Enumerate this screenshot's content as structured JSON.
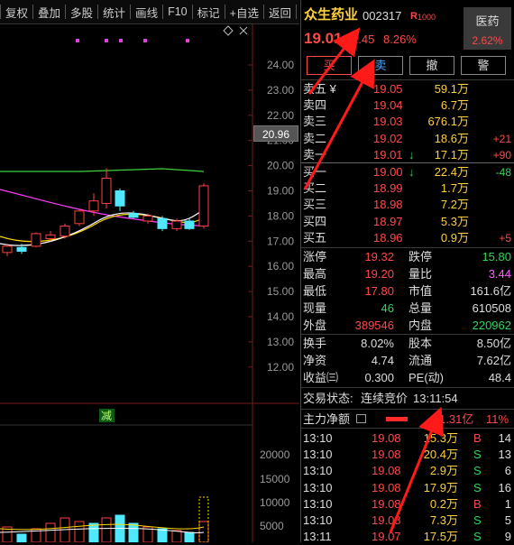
{
  "toolbar": {
    "items": [
      "复权",
      "叠加",
      "多股",
      "统计",
      "画线",
      "F10",
      "标记",
      "+自选",
      "返回"
    ]
  },
  "chart": {
    "price_axis": [
      "24.00",
      "23.00",
      "22.00",
      "21.00",
      "20.00",
      "19.00",
      "18.00",
      "17.00",
      "16.00",
      "15.00",
      "14.00",
      "13.00",
      "12.00"
    ],
    "current_price_box": "20.96",
    "volume_axis": [
      "20000",
      "15000",
      "10000",
      "5000"
    ],
    "marker_text": "减",
    "diamond_icon": "diamond-icon",
    "close_icon": "close-icon",
    "candle_up_color": "#ff4040",
    "candle_down_color": "#4fe8ff",
    "ma_colors": [
      "#ffffff",
      "#ffd800",
      "#ff3cff",
      "#3cd23c"
    ]
  },
  "quote": {
    "name": "众生药业",
    "code": "002317",
    "badge": "R",
    "badge_sub": "1000",
    "sector": "医药",
    "sector_change": "2.62%",
    "price": "19.01",
    "change": "1.45",
    "change_pct": "8.26%"
  },
  "actions": [
    "买",
    "卖",
    "撤",
    "警"
  ],
  "sell": [
    {
      "label": "卖五 ¥",
      "price": "19.05",
      "vol": "59.1万",
      "delta": ""
    },
    {
      "label": "卖四",
      "price": "19.04",
      "vol": "6.7万",
      "delta": ""
    },
    {
      "label": "卖三",
      "price": "19.03",
      "vol": "676.1万",
      "delta": ""
    },
    {
      "label": "卖二",
      "price": "19.02",
      "vol": "18.6万",
      "delta": "+21"
    },
    {
      "label": "卖一",
      "price": "19.01",
      "arrow": "↓",
      "vol": "17.1万",
      "delta": "+90"
    }
  ],
  "buy": [
    {
      "label": "买一",
      "price": "19.00",
      "arrow": "↓",
      "vol": "22.4万",
      "delta": "-48"
    },
    {
      "label": "买二",
      "price": "18.99",
      "vol": "1.7万",
      "delta": ""
    },
    {
      "label": "买三",
      "price": "18.98",
      "vol": "7.2万",
      "delta": ""
    },
    {
      "label": "买四",
      "price": "18.97",
      "vol": "5.3万",
      "delta": ""
    },
    {
      "label": "买五",
      "price": "18.96",
      "vol": "0.9万",
      "delta": "+5"
    }
  ],
  "stats1": [
    {
      "l1": "涨停",
      "v1": "19.32",
      "l2": "跌停",
      "v2": "15.80"
    },
    {
      "l1": "最高",
      "v1": "19.20",
      "l2": "量比",
      "v2": "3.44"
    },
    {
      "l1": "最低",
      "v1": "17.80",
      "l2": "市值",
      "v2": "161.6亿"
    },
    {
      "l1": "现量",
      "v1": "46",
      "l2": "总量",
      "v2": "610508"
    },
    {
      "l1": "外盘",
      "v1": "389546",
      "l2": "内盘",
      "v2": "220962"
    }
  ],
  "stats2": [
    {
      "l1": "换手",
      "v1": "8.02%",
      "l2": "股本",
      "v2": "8.50亿"
    },
    {
      "l1": "净资",
      "v1": "4.74",
      "l2": "流通",
      "v2": "7.62亿"
    },
    {
      "l1": "收益(",
      "v1": "0.300",
      "l2": "PE(动)",
      "v2": "48.4"
    }
  ],
  "stats2_labels_fix": {
    "eps": "收益㈢"
  },
  "trade_status": {
    "label": "交易状态:",
    "value": "连续竞价",
    "time": "13:11:54"
  },
  "main_flow": {
    "label": "主力净额",
    "value": "1.31亿",
    "pct": "11%"
  },
  "ticks": [
    {
      "time": "13:10",
      "price": "19.08",
      "vol": "15.3万",
      "side": "B",
      "n": "14"
    },
    {
      "time": "13:10",
      "price": "19.08",
      "vol": "20.4万",
      "side": "S",
      "n": "13"
    },
    {
      "time": "13:10",
      "price": "19.08",
      "vol": "2.9万",
      "side": "S",
      "n": "6"
    },
    {
      "time": "13:10",
      "price": "19.08",
      "vol": "17.9万",
      "side": "S",
      "n": "16"
    },
    {
      "time": "13:10",
      "price": "19.08",
      "vol": "0.2万",
      "side": "B",
      "n": "1"
    },
    {
      "time": "13:10",
      "price": "19.08",
      "vol": "7.3万",
      "side": "S",
      "n": "5"
    },
    {
      "time": "13:11",
      "price": "19.07",
      "vol": "17.5万",
      "side": "S",
      "n": "9"
    }
  ]
}
